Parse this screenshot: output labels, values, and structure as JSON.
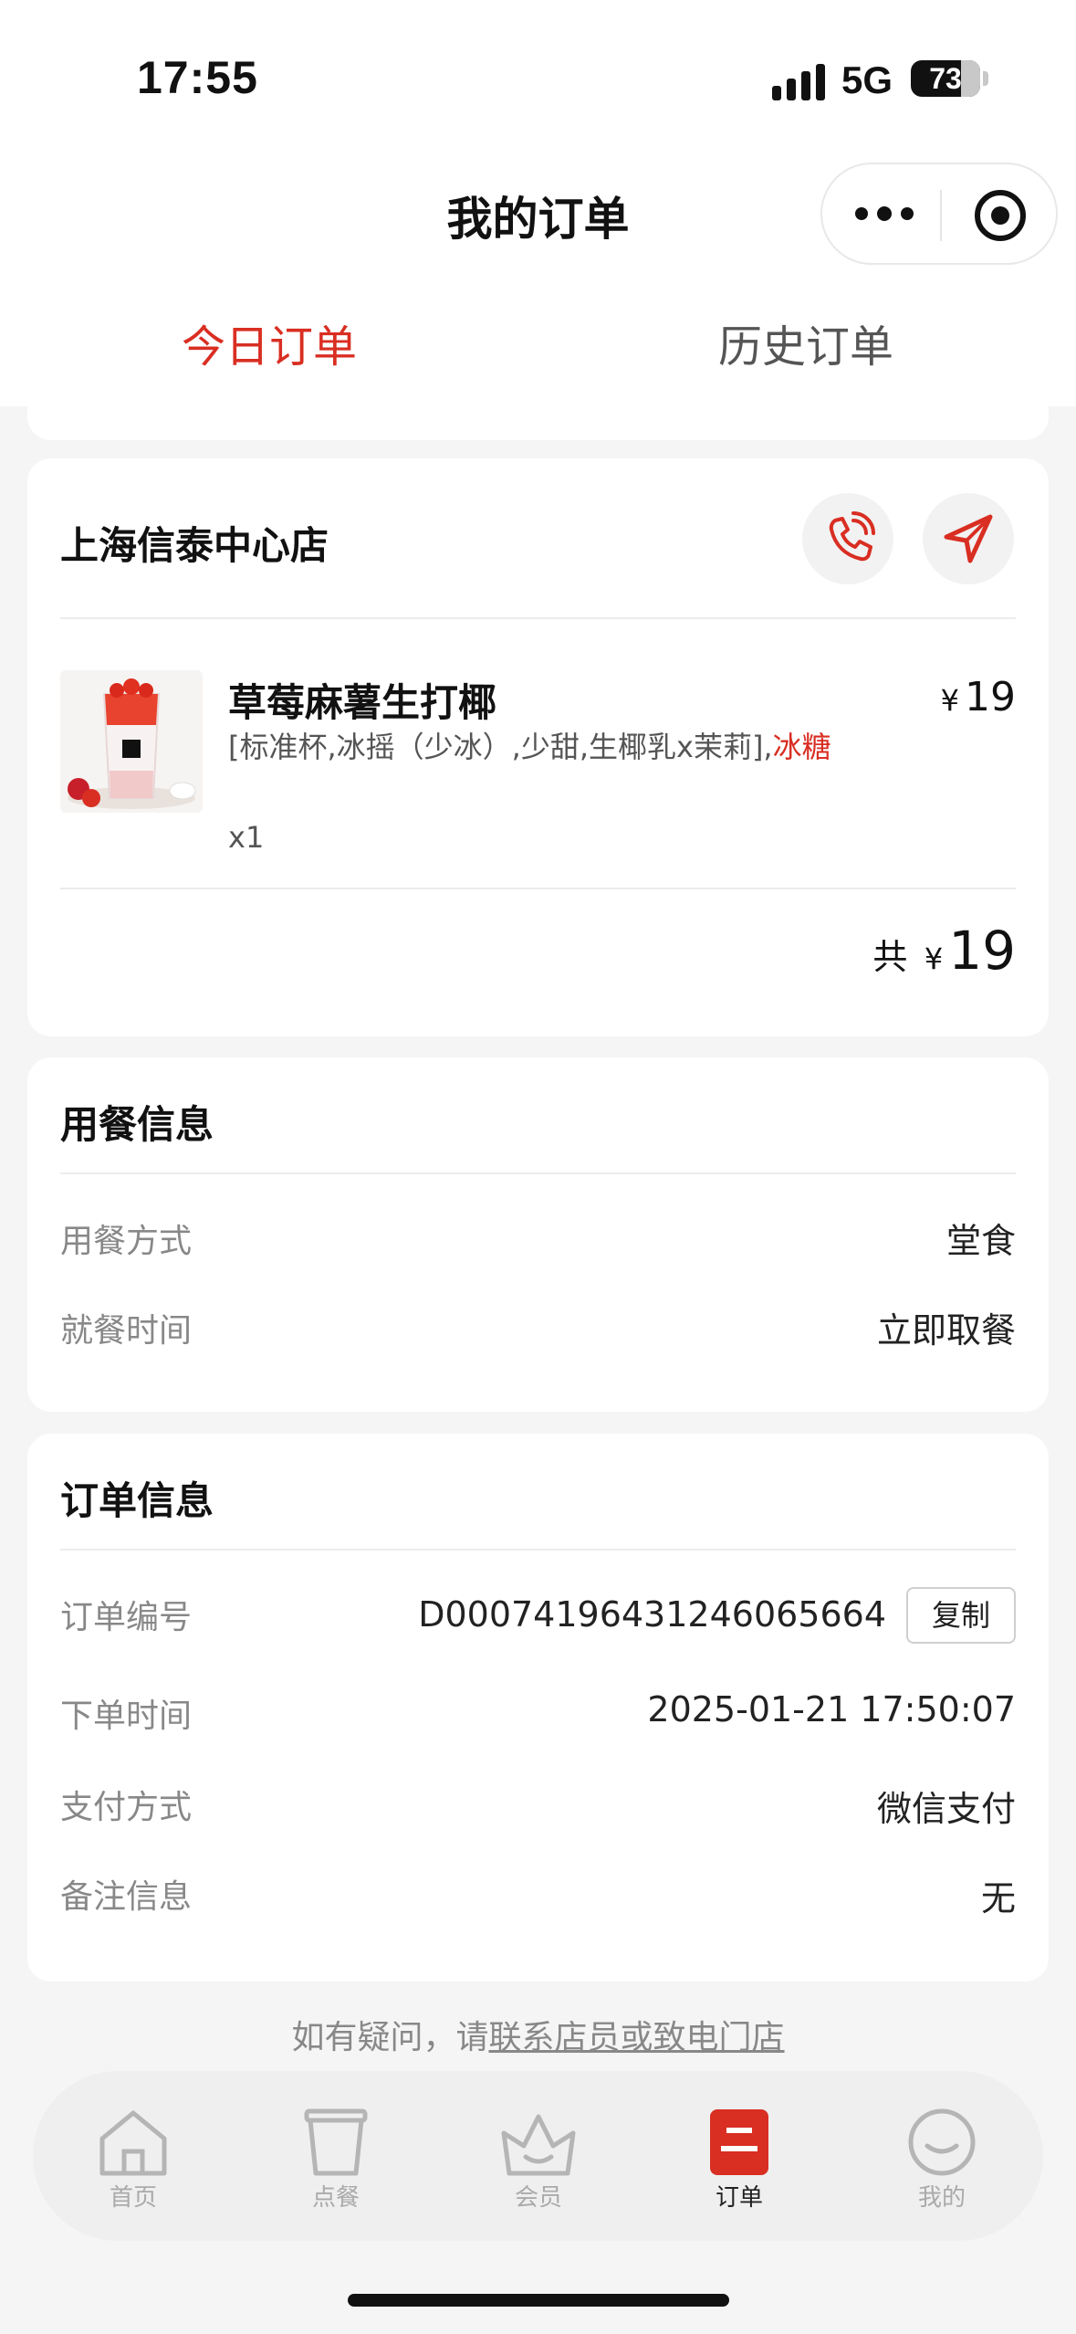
{
  "status_bar": {
    "time": "17:55",
    "network": "5G",
    "battery": "73",
    "battery_level_percent": 73
  },
  "header": {
    "title": "我的订单",
    "more_icon": "more-dots-icon",
    "close_icon": "target-close-icon"
  },
  "tabs": [
    {
      "label": "今日订单",
      "active": true
    },
    {
      "label": "历史订单",
      "active": false
    }
  ],
  "store": {
    "name": "上海信泰中心店",
    "call_icon": "phone-icon",
    "navigate_icon": "navigation-arrow-icon"
  },
  "item": {
    "name": "草莓麻薯生打椰",
    "price_symbol": "¥",
    "price": "19",
    "spec_main": "[标准杯,冰摇（少冰）,少甜,生椰乳x茉莉],",
    "spec_highlight": "冰糖",
    "quantity": "x1"
  },
  "total": {
    "label": "共",
    "symbol": "¥",
    "amount": "19"
  },
  "meal_info": {
    "heading": "用餐信息",
    "rows": [
      {
        "label": "用餐方式",
        "value": "堂食"
      },
      {
        "label": "就餐时间",
        "value": "立即取餐"
      }
    ]
  },
  "order_info": {
    "heading": "订单信息",
    "order_no_label": "订单编号",
    "order_no": "D0007419643124606566​4",
    "copy_label": "复制",
    "rows": [
      {
        "label": "下单时间",
        "value": "2025-01-21 17:50:07"
      },
      {
        "label": "支付方式",
        "value": "微信支付"
      },
      {
        "label": "备注信息",
        "value": "无"
      }
    ]
  },
  "help": {
    "prefix": "如有疑问，请",
    "link": "联系店员或致电门店"
  },
  "tabbar": [
    {
      "label": "首页",
      "icon": "home-icon",
      "active": false
    },
    {
      "label": "点餐",
      "icon": "cup-icon",
      "active": false
    },
    {
      "label": "会员",
      "icon": "crown-icon",
      "active": false
    },
    {
      "label": "订单",
      "icon": "order-icon",
      "active": true
    },
    {
      "label": "我的",
      "icon": "smile-icon",
      "active": false
    }
  ],
  "colors": {
    "accent": "#d92e22",
    "muted": "#888888",
    "background": "#f5f5f5"
  }
}
